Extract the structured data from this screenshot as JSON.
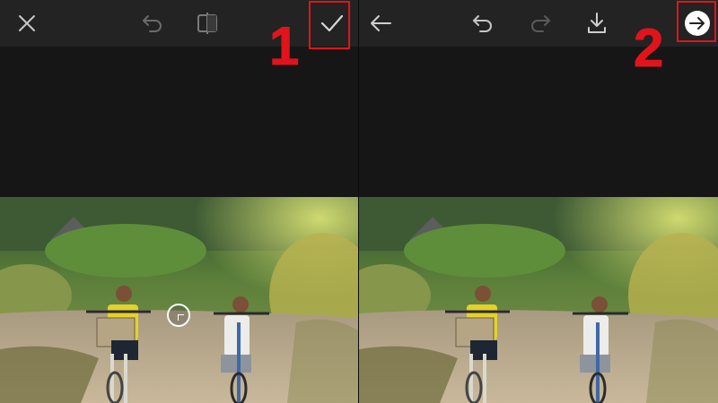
{
  "left_toolbar": {
    "close_icon": "close-icon",
    "undo_icon": "undo-icon",
    "compare_icon": "compare-split-icon",
    "apply_icon": "checkmark-icon"
  },
  "right_toolbar": {
    "back_icon": "arrow-left-icon",
    "undo_icon": "undo-icon",
    "redo_icon": "redo-icon",
    "download_icon": "download-icon",
    "next_icon": "arrow-right-circle-icon"
  },
  "annotations": {
    "step_1": "1",
    "step_2": "2",
    "highlight_color": "#e0141c"
  },
  "colors": {
    "toolbar_bg": "#232323",
    "canvas_bg": "#161616",
    "icon": "#bdbdbd"
  }
}
